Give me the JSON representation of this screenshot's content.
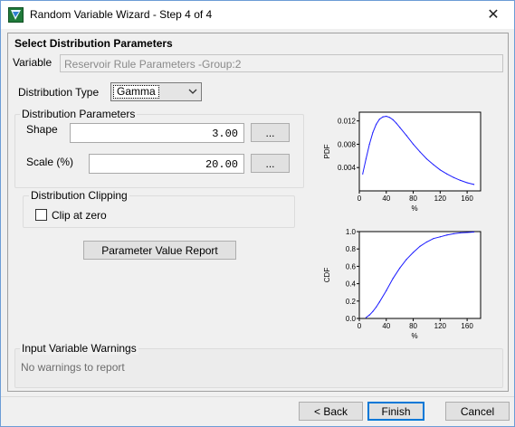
{
  "window": {
    "title": "Random Variable Wizard - Step 4 of 4",
    "close_glyph": "✕"
  },
  "header": {
    "section_title": "Select Distribution Parameters"
  },
  "variable": {
    "label": "Variable",
    "value": "Reservoir Rule Parameters -Group:2"
  },
  "distribution_type": {
    "label": "Distribution Type",
    "selected": "Gamma"
  },
  "parameters": {
    "group_label": "Distribution Parameters",
    "shape_label": "Shape",
    "shape_value": "3.00",
    "scale_label": "Scale (%)",
    "scale_value": "20.00",
    "browse_label": "..."
  },
  "clipping": {
    "group_label": "Distribution Clipping",
    "clip_label": "Clip at zero",
    "clip_checked": false
  },
  "report_button": "Parameter Value Report",
  "warnings": {
    "group_label": "Input Variable Warnings",
    "text": "No warnings to report"
  },
  "footer": {
    "back_label": "< Back",
    "finish_label": "Finish",
    "cancel_label": "Cancel"
  },
  "colors": {
    "curve": "#1a1aff",
    "default_button_border": "#0078d7"
  },
  "chart_data": [
    {
      "type": "line",
      "ylabel": "PDF",
      "xlabel": "%",
      "x_ticks": [
        "0",
        "40",
        "80",
        "120",
        "160"
      ],
      "y_ticks": [
        "0.004",
        "0.008",
        "0.012"
      ],
      "xlim": [
        0,
        180
      ],
      "ylim": [
        0,
        0.0135
      ],
      "series": [
        {
          "x": [
            5,
            10,
            15,
            20,
            25,
            30,
            35,
            40,
            45,
            50,
            55,
            60,
            70,
            80,
            90,
            100,
            110,
            120,
            130,
            140,
            150,
            160,
            170
          ],
          "y": [
            0.0029,
            0.0055,
            0.008,
            0.01,
            0.0114,
            0.0123,
            0.0127,
            0.0128,
            0.0126,
            0.0122,
            0.0116,
            0.0109,
            0.0095,
            0.008,
            0.0067,
            0.0055,
            0.0045,
            0.0036,
            0.0029,
            0.0023,
            0.0018,
            0.0014,
            0.0011
          ]
        }
      ]
    },
    {
      "type": "line",
      "ylabel": "CDF",
      "xlabel": "%",
      "x_ticks": [
        "0",
        "40",
        "80",
        "120",
        "160"
      ],
      "y_ticks": [
        "0.0",
        "0.2",
        "0.4",
        "0.6",
        "0.8",
        "1.0"
      ],
      "xlim": [
        0,
        180
      ],
      "ylim": [
        0,
        1.0
      ],
      "series": [
        {
          "x": [
            10,
            15,
            20,
            25,
            30,
            40,
            50,
            60,
            70,
            80,
            90,
            100,
            110,
            120,
            130,
            140,
            150,
            160,
            170
          ],
          "y": [
            0.01,
            0.04,
            0.08,
            0.13,
            0.19,
            0.32,
            0.46,
            0.58,
            0.68,
            0.76,
            0.83,
            0.88,
            0.92,
            0.94,
            0.96,
            0.975,
            0.985,
            0.99,
            0.995
          ]
        }
      ]
    }
  ]
}
